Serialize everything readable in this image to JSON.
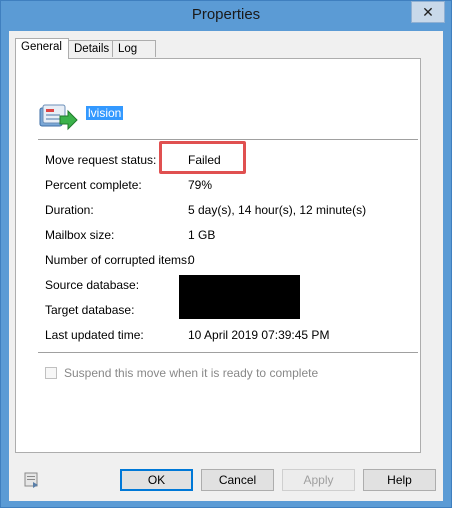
{
  "window": {
    "title": "Properties",
    "close_label": "✕"
  },
  "tabs": [
    {
      "label": "General",
      "active": true
    },
    {
      "label": "Details",
      "active": false
    },
    {
      "label": "Log",
      "active": false
    }
  ],
  "general": {
    "mailbox_name": "lvision",
    "fields": [
      {
        "label": "Move request status:",
        "value": "Failed"
      },
      {
        "label": "Percent complete:",
        "value": "79%"
      },
      {
        "label": "Duration:",
        "value": "5 day(s), 14 hour(s), 12 minute(s)"
      },
      {
        "label": "Mailbox size:",
        "value": "1 GB"
      },
      {
        "label": "Number of corrupted items:",
        "value": "0"
      },
      {
        "label": "Source database:",
        "value": ""
      },
      {
        "label": "Target database:",
        "value": ""
      },
      {
        "label": "Last updated time:",
        "value": "10 April 2019 07:39:45 PM"
      }
    ],
    "suspend_label": "Suspend this move when it is ready to complete",
    "suspend_checked": false
  },
  "buttons": {
    "ok": "OK",
    "cancel": "Cancel",
    "apply": "Apply",
    "help": "Help"
  },
  "colors": {
    "titlebar": "#5b9bd5",
    "highlight_box": "#e05050",
    "selection": "#3399ff"
  }
}
